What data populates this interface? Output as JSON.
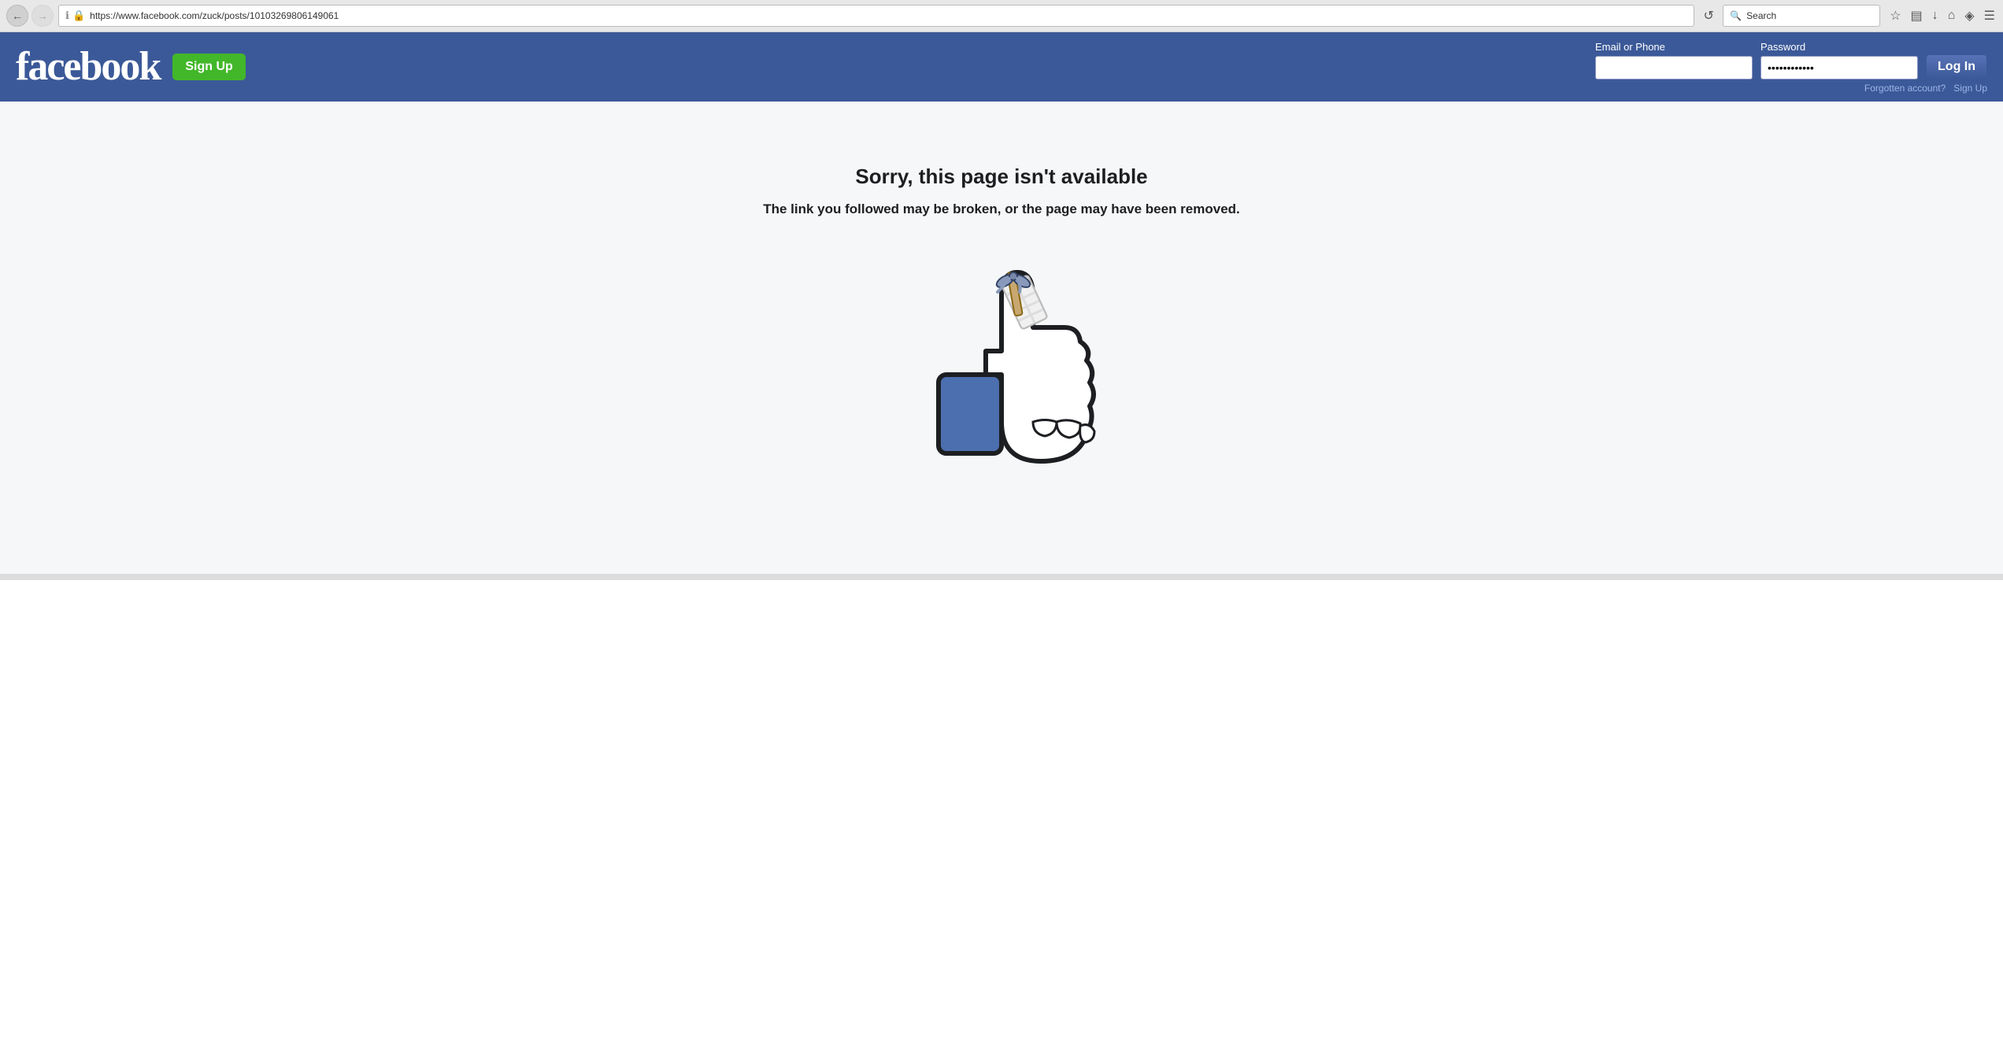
{
  "browser": {
    "back_button": "←",
    "forward_button": "→",
    "reload_button": "↺",
    "url": "https://www.facebook.com/zuck/posts/10103269806149061",
    "search_placeholder": "Search",
    "search_value": "Search",
    "toolbar_icons": {
      "bookmark": "☆",
      "bookmarks_bar": "▤",
      "download": "↓",
      "home": "⌂",
      "pocket": "◈",
      "menu": "☰"
    }
  },
  "header": {
    "logo": "facebook",
    "signup_label": "Sign Up",
    "email_label": "Email or Phone",
    "password_label": "Password",
    "password_value": "••••••••••••",
    "login_label": "Log In",
    "forgotten_label": "Forgotten account?",
    "signup_link_label": "Sign Up"
  },
  "error_page": {
    "title": "Sorry, this page isn't available",
    "subtitle": "The link you followed may be broken, or the page may have been removed."
  }
}
